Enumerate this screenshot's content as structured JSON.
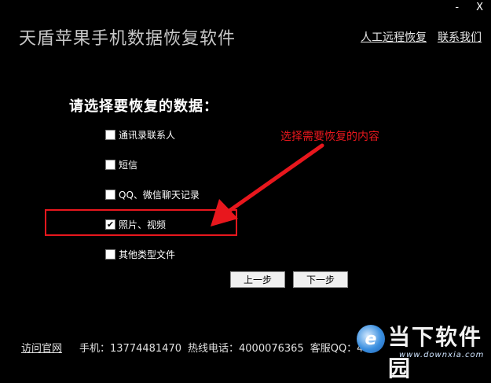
{
  "window": {
    "minimize_label": "-",
    "close_label": "X"
  },
  "header": {
    "title": "天盾苹果手机数据恢复软件",
    "links": [
      "人工远程恢复",
      "联系我们"
    ]
  },
  "prompt": "请选择要恢复的数据：",
  "options": [
    {
      "label": "通讯录联系人",
      "checked": false
    },
    {
      "label": "短信",
      "checked": false
    },
    {
      "label": "QQ、微信聊天记录",
      "checked": false
    },
    {
      "label": "照片、视频",
      "checked": true
    },
    {
      "label": "其他类型文件",
      "checked": false
    }
  ],
  "annotation": {
    "text": "选择需要恢复的内容",
    "color": "#e8171d"
  },
  "buttons": {
    "prev": "上一步",
    "next": "下一步"
  },
  "footer": {
    "visit_site": "访问官网",
    "phone": "手机：13774481470",
    "hotline": "热线电话：4000076365",
    "customer_qq": "客服QQ：4"
  },
  "watermark": {
    "logo_char": "e",
    "text": "当下软件园",
    "url": "www.downxia.com"
  }
}
